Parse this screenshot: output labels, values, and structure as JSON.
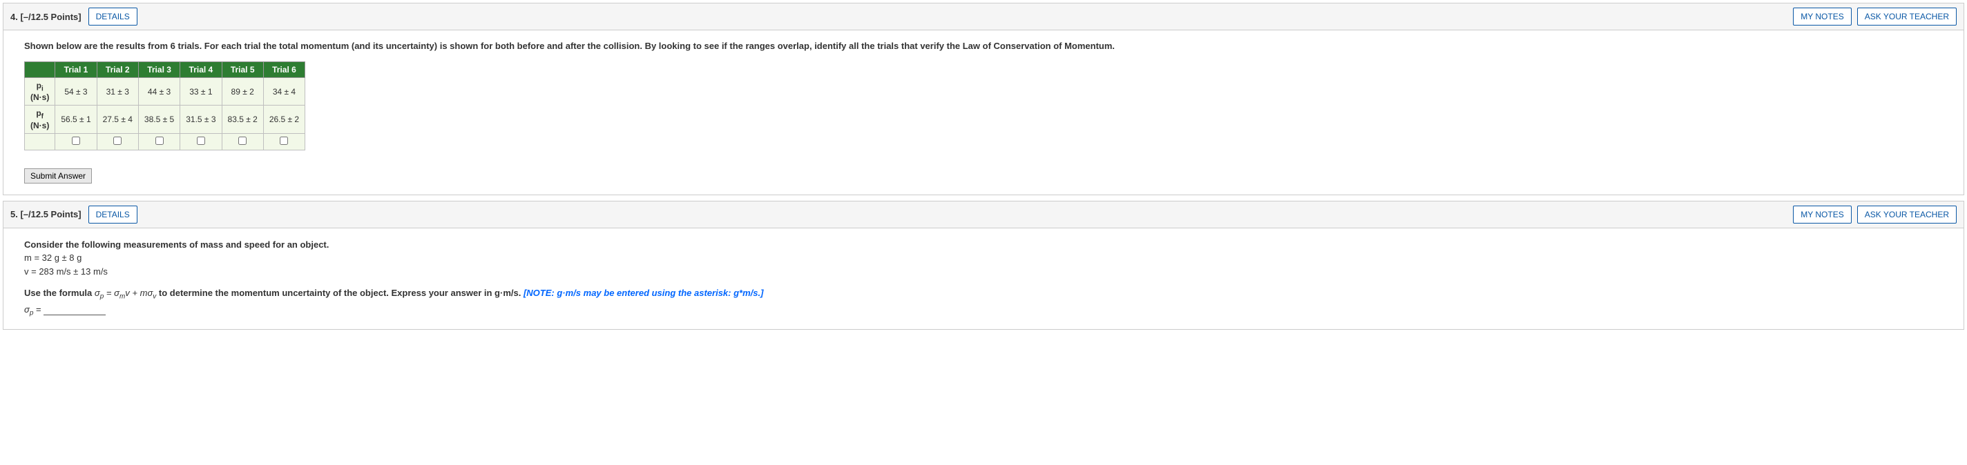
{
  "q4": {
    "number": "4.",
    "points": "[–/12.5 Points]",
    "details": "DETAILS",
    "mynotes": "MY NOTES",
    "ask": "ASK YOUR TEACHER",
    "prompt": "Shown below are the results from 6 trials. For each trial the total momentum (and its uncertainty) is shown for both before and after the collision. By looking to see if the ranges overlap, identify all the trials that verify the Law of Conservation of Momentum.",
    "trial_headers": [
      "Trial 1",
      "Trial 2",
      "Trial 3",
      "Trial 4",
      "Trial 5",
      "Trial 6"
    ],
    "row1_label_sym": "p",
    "row1_label_sub": "i",
    "row_unit": "(N·s)",
    "row2_label_sym": "p",
    "row2_label_sub": "f",
    "row1": [
      "54 ± 3",
      "31 ± 3",
      "44 ± 3",
      "33 ± 1",
      "89 ± 2",
      "34 ± 4"
    ],
    "row2": [
      "56.5 ± 1",
      "27.5 ± 4",
      "38.5 ± 5",
      "31.5 ± 3",
      "83.5 ± 2",
      "26.5 ± 2"
    ],
    "submit": "Submit Answer"
  },
  "q5": {
    "number": "5.",
    "points": "[–/12.5 Points]",
    "details": "DETAILS",
    "mynotes": "MY NOTES",
    "ask": "ASK YOUR TEACHER",
    "intro": "Consider the following measurements of mass and speed for an object.",
    "m_line": "m = 32 g ± 8 g",
    "v_line": "v = 283 m/s ± 13 m/s",
    "formula_lead": "Use the formula  ",
    "formula_sp": "σ",
    "formula_p": "p",
    "formula_eq": " = ",
    "formula_sm": "σ",
    "formula_m": "m",
    "formula_v1": "v + m",
    "formula_sv": "σ",
    "formula_v2": "v",
    "formula_tail": "  to determine the momentum uncertainty of the object. Express your answer in g·m/s. ",
    "note": "[NOTE: g·m/s may be entered using the asterisk: g*m/s.]",
    "answer_label_s": "σ",
    "answer_label_p": "p",
    "answer_label_eq": " = "
  }
}
